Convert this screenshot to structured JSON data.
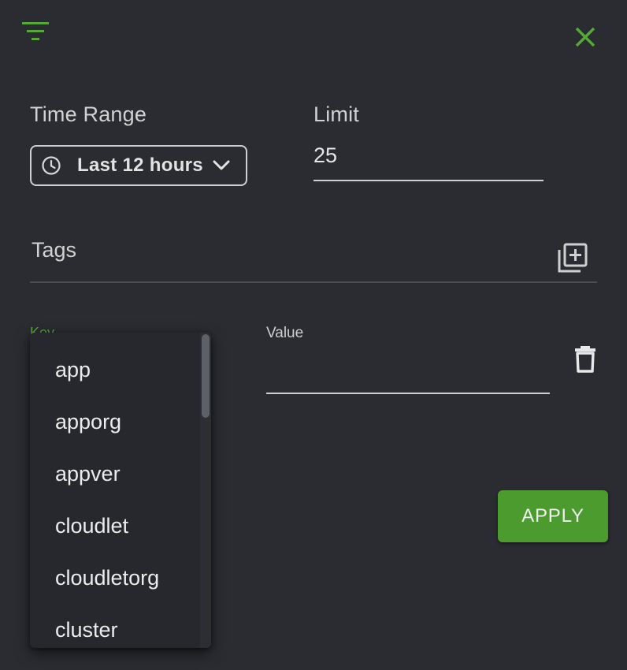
{
  "header": {
    "filter_icon": "filter-icon",
    "close_icon": "close-icon"
  },
  "time_range": {
    "label": "Time Range",
    "value": "Last 12 hours",
    "icon": "clock-icon",
    "chevron": "chevron-down-icon"
  },
  "limit": {
    "label": "Limit",
    "value": "25"
  },
  "tags": {
    "label": "Tags",
    "add_icon": "add-box-icon"
  },
  "tag_row": {
    "key_label": "Key",
    "value_label": "Value",
    "value": "",
    "delete_icon": "delete-icon"
  },
  "key_dropdown": {
    "items": [
      "app",
      "apporg",
      "appver",
      "cloudlet",
      "cloudletorg",
      "cluster"
    ]
  },
  "apply_button": {
    "label": "APPLY"
  },
  "colors": {
    "accent": "#55a935",
    "button": "#4b9b2f",
    "background": "#2a2c31",
    "dropdown": "#26282d"
  }
}
